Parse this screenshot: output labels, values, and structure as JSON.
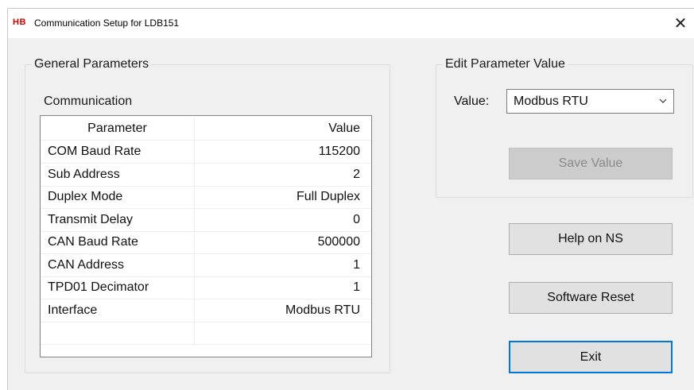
{
  "window": {
    "logo": "HB",
    "title": "Communication Setup for LDB151",
    "close_glyph": "✕"
  },
  "general": {
    "group_title": "General Parameters",
    "section_label": "Communication",
    "columns": [
      "Parameter",
      "Value"
    ],
    "rows": [
      {
        "param": "COM Baud Rate",
        "value": "115200"
      },
      {
        "param": "Sub Address",
        "value": "2"
      },
      {
        "param": "Duplex Mode",
        "value": "Full Duplex"
      },
      {
        "param": "Transmit Delay",
        "value": "0"
      },
      {
        "param": "CAN Baud Rate",
        "value": "500000"
      },
      {
        "param": "CAN Address",
        "value": "1"
      },
      {
        "param": "TPD01 Decimator",
        "value": "1"
      },
      {
        "param": "Interface",
        "value": "Modbus RTU"
      },
      {
        "param": "",
        "value": ""
      }
    ]
  },
  "edit": {
    "group_title": "Edit Parameter Value",
    "value_label": "Value:",
    "selected_value": "Modbus RTU",
    "save_label": "Save Value",
    "save_enabled": false
  },
  "buttons": {
    "help": "Help on NS",
    "reset": "Software Reset",
    "exit": "Exit"
  },
  "colors": {
    "logo": "#d40000",
    "focus_border": "#0078d7",
    "window_bg": "#f0f0f0"
  }
}
